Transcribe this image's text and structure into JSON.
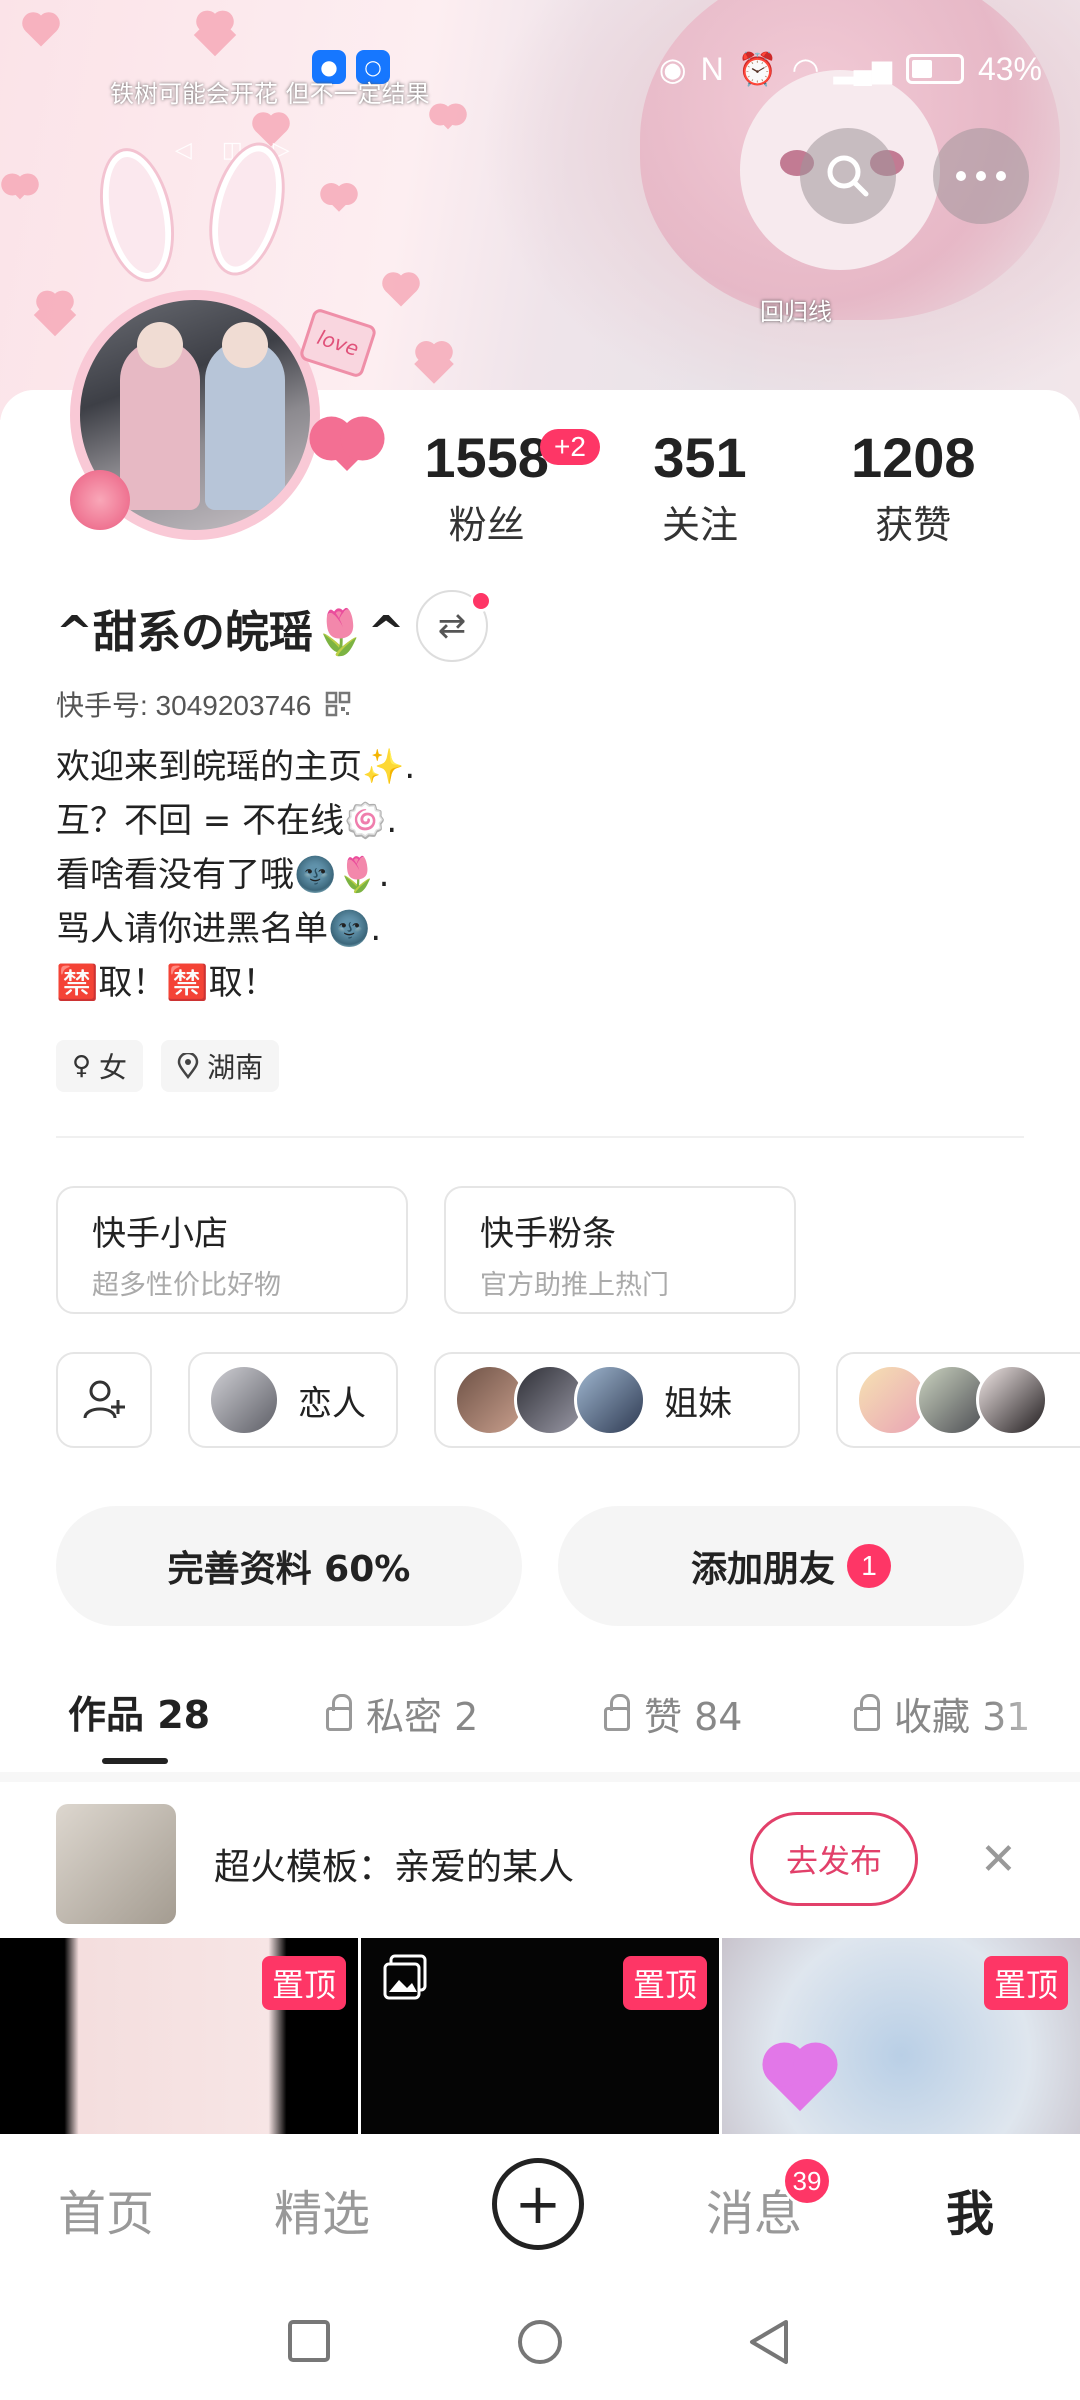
{
  "banner": {
    "song_lyric": "铁树可能会开花 但不一定结果",
    "tag_text": "回归线"
  },
  "status_bar": {
    "battery_percent": "43%"
  },
  "profile": {
    "username": "^甜系の皖瑶🌷^",
    "kuaishou_id_label": "快手号: 3049203746",
    "bio_lines": [
      "欢迎来到皖瑶的主页✨.",
      "互？不回 = 不在线🍥.",
      "看啥看没有了哦🌚🌷.",
      "骂人请你进黑名单🌚.",
      "🈲取！🈲取！"
    ],
    "bio_ban_char": "禁",
    "bio_ban_rest": "取!",
    "gender_chip": "女",
    "location_chip": "湖南"
  },
  "stats": {
    "fans_count": "1558",
    "fans_badge": "+2",
    "fans_label": "粉丝",
    "following_count": "351",
    "following_label": "关注",
    "likes_count": "1208",
    "likes_label": "获赞"
  },
  "services": {
    "shop_title": "快手小店",
    "shop_sub": "超多性价比好物",
    "promo_title": "快手粉条",
    "promo_sub": "官方助推上热门"
  },
  "relations": {
    "lovers_label": "恋人",
    "sisters_label": "姐妹"
  },
  "actions": {
    "complete_profile": "完善资料 60%",
    "add_friends": "添加朋友",
    "add_friends_badge": "1"
  },
  "tabs": {
    "works": "作品 28",
    "private": "私密 2",
    "likes": "赞 84",
    "favorites": "收藏 31"
  },
  "template": {
    "text": "超火模板：亲爱的某人",
    "button": "去发布"
  },
  "grid": {
    "pin_label": "置顶"
  },
  "bottom_nav": {
    "home": "首页",
    "featured": "精选",
    "messages": "消息",
    "messages_badge": "39",
    "me": "我"
  },
  "colors": {
    "accent_red": "#fe3666",
    "template_button": "#e2406a"
  }
}
